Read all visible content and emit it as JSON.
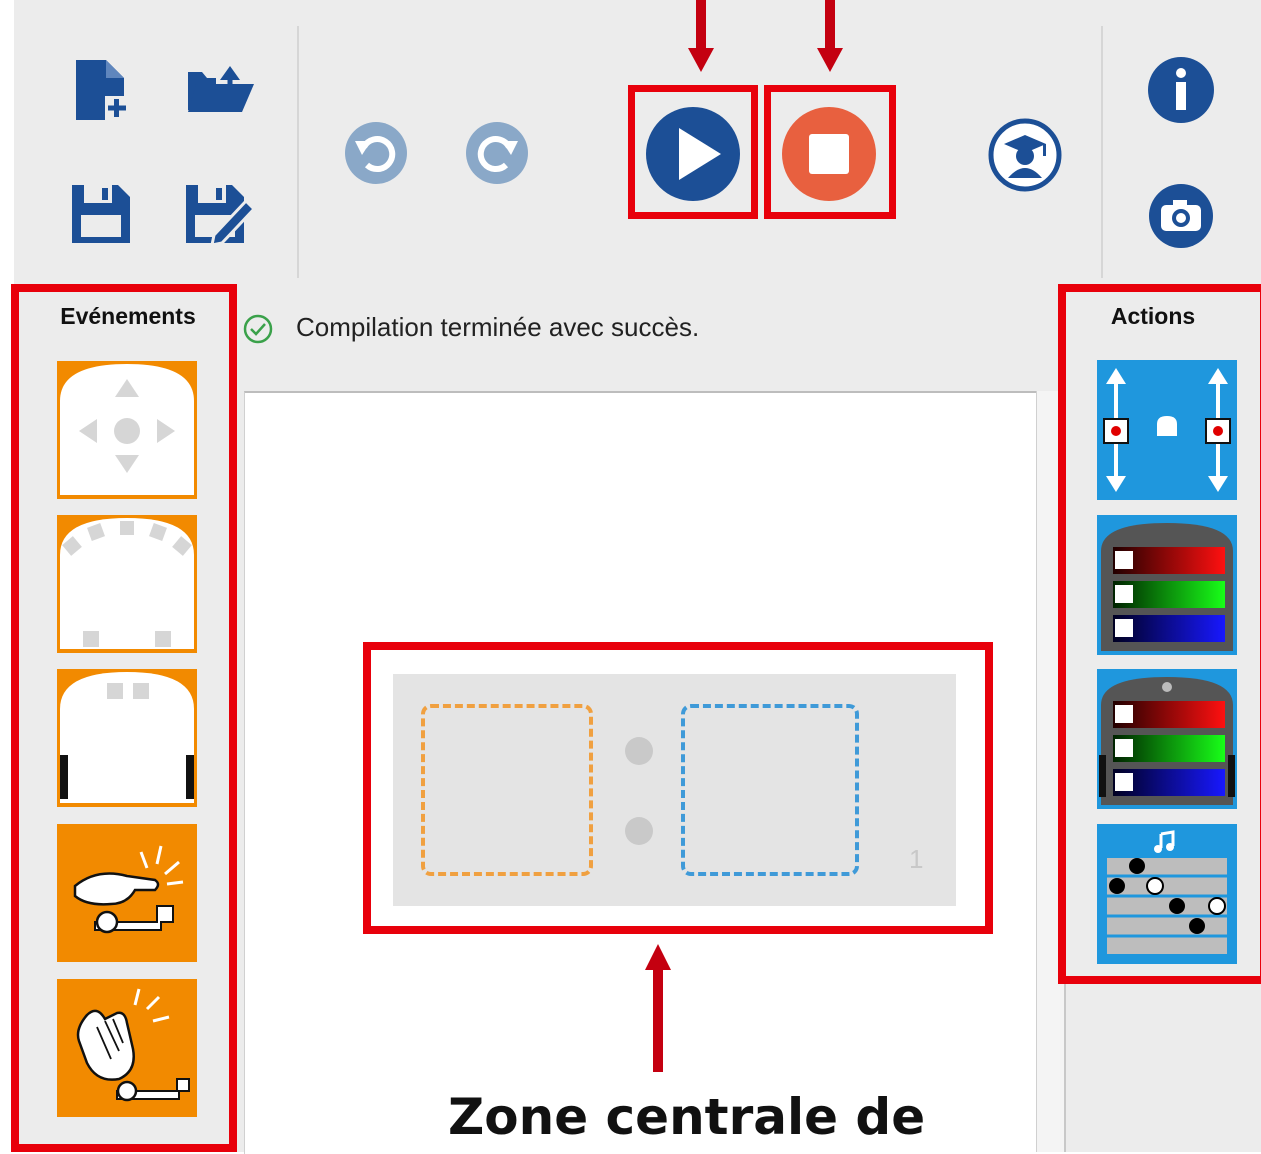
{
  "colors": {
    "accent_red": "#e8000b",
    "event_orange": "#f28a00",
    "action_blue": "#1f97dd",
    "toolbar_blue": "#1c4f96",
    "stop_orange": "#e8603f",
    "undo_grey_blue": "#8aa8c8",
    "success_green": "#3aa14a",
    "window_grey": "#ececec"
  },
  "toolbar": {
    "icons": [
      "new-file-icon",
      "open-folder-icon",
      "save-icon",
      "save-as-icon",
      "undo-icon",
      "redo-icon",
      "play-icon",
      "stop-icon",
      "teacher-mode-icon",
      "info-icon",
      "camera-icon"
    ]
  },
  "status": {
    "icon": "check-circle-icon",
    "text": "Compilation terminée avec succès."
  },
  "events_panel": {
    "title": "Evénements",
    "blocks": [
      "buttons-event-icon",
      "front-sensors-event-icon",
      "ground-sensors-event-icon",
      "tap-event-icon",
      "clap-event-icon"
    ]
  },
  "actions_panel": {
    "title": "Actions",
    "blocks": [
      "motors-action-icon",
      "top-color-action-icon",
      "bottom-color-action-icon",
      "music-action-icon"
    ]
  },
  "editor": {
    "event_action_pair": {
      "row_number": "1"
    }
  },
  "annotation": {
    "caption": "Zone centrale de"
  }
}
